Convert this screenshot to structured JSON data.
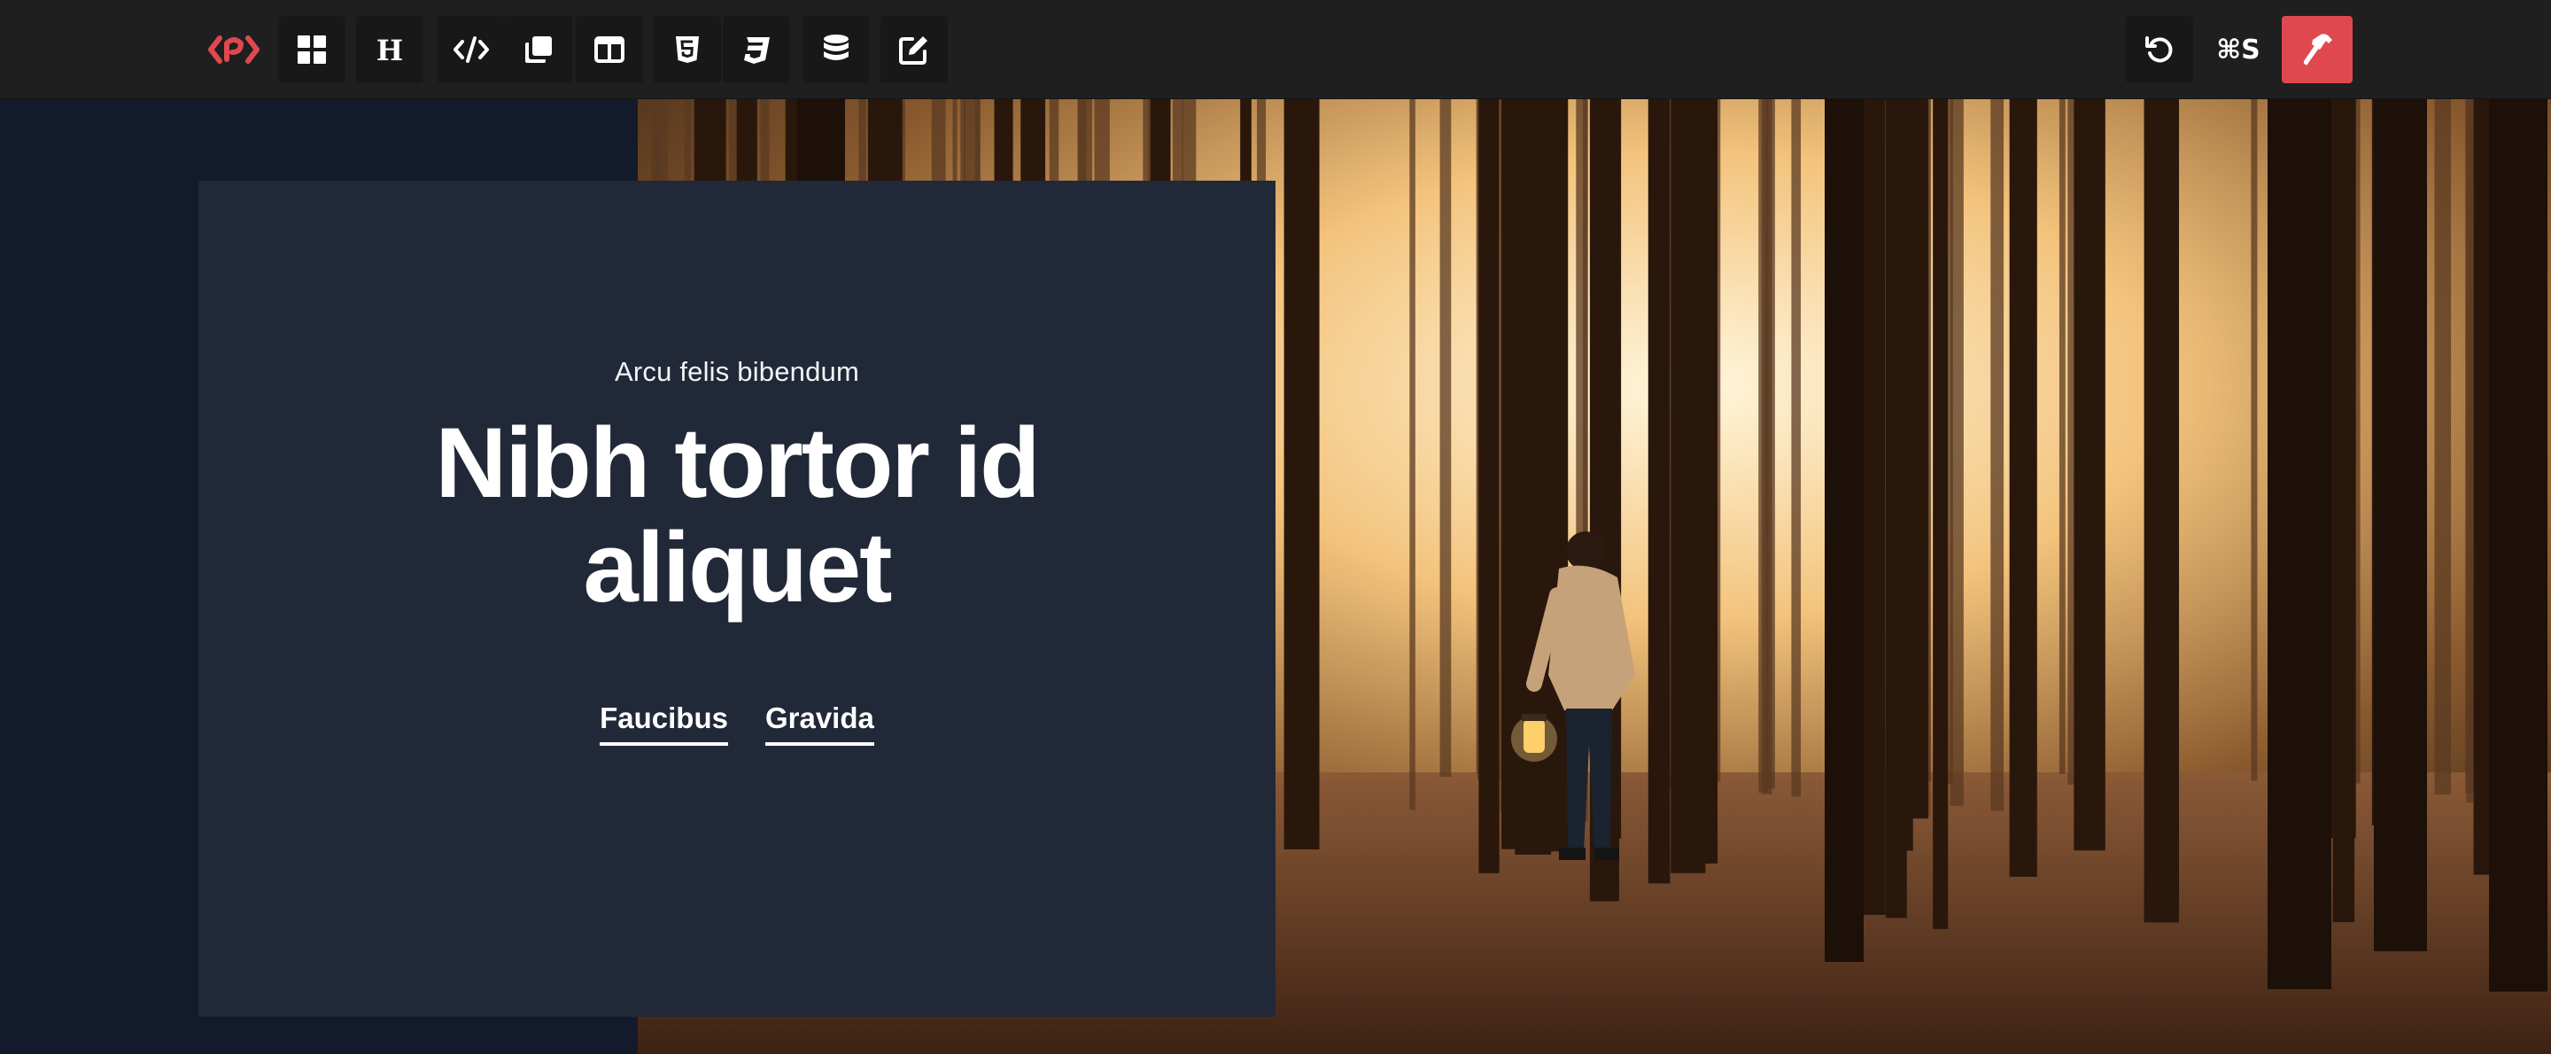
{
  "toolbar": {
    "icons": [
      "brand-logo-icon",
      "blocks-icon",
      "heading-icon",
      "code-icon",
      "copy-icon",
      "layout-columns-icon",
      "html5-icon",
      "css3-icon",
      "database-icon",
      "edit-icon",
      "undo-icon",
      "build-hammer-icon"
    ],
    "shortcut_label": "⌘S"
  },
  "colors": {
    "brand": "#e0484f",
    "toolbar_bg": "#1f1f1f",
    "card_bg": "#212837",
    "page_bg": "#131a2b"
  },
  "hero": {
    "eyebrow": "Arcu felis bibendum",
    "headline": "Nibh tortor id aliquet",
    "links": [
      "Faucibus",
      "Gravida"
    ]
  }
}
